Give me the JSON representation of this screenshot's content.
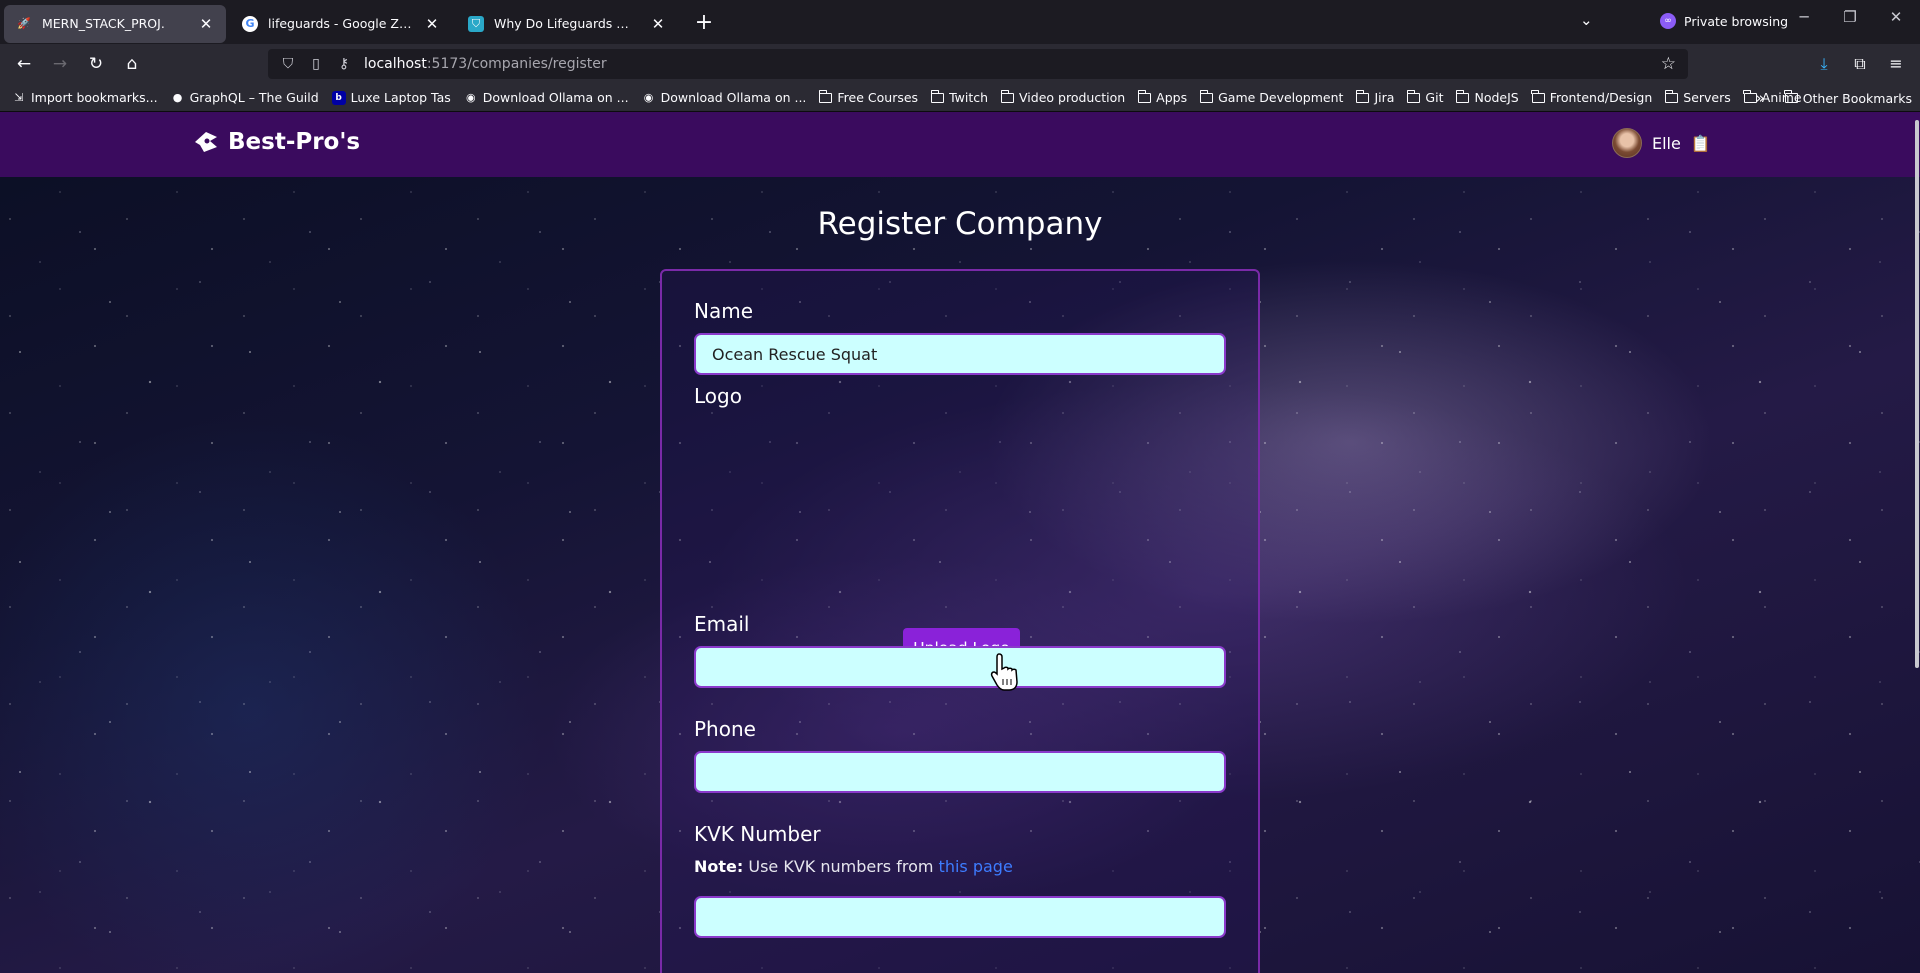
{
  "browser": {
    "tabs": [
      {
        "title": "MERN_STACK_PROJ.",
        "active": true,
        "favicon": "rocket-icon"
      },
      {
        "title": "lifeguards - Google Zoeken",
        "active": false,
        "favicon": "google-icon"
      },
      {
        "title": "Why Do Lifeguards Wear Red?",
        "active": false,
        "favicon": "shield-icon"
      }
    ],
    "private_label": "Private browsing",
    "url_host": "localhost",
    "url_path": ":5173/companies/register",
    "bookmarks": [
      {
        "label": "Import bookmarks...",
        "icon": "import-icon"
      },
      {
        "label": "GraphQL – The Guild",
        "icon": "guild-icon"
      },
      {
        "label": "Luxe Laptop Tas",
        "icon": "bol-icon"
      },
      {
        "label": "Download Ollama on ...",
        "icon": "ollama-icon"
      },
      {
        "label": "Download Ollama on ...",
        "icon": "ollama-icon"
      },
      {
        "label": "Free Courses",
        "icon": "folder-icon"
      },
      {
        "label": "Twitch",
        "icon": "folder-icon"
      },
      {
        "label": "Video production",
        "icon": "folder-icon"
      },
      {
        "label": "Apps",
        "icon": "folder-icon"
      },
      {
        "label": "Game Development",
        "icon": "folder-icon"
      },
      {
        "label": "Jira",
        "icon": "folder-icon"
      },
      {
        "label": "Git",
        "icon": "folder-icon"
      },
      {
        "label": "NodeJS",
        "icon": "folder-icon"
      },
      {
        "label": "Frontend/Design",
        "icon": "folder-icon"
      },
      {
        "label": "Servers",
        "icon": "folder-icon"
      },
      {
        "label": "Anime",
        "icon": "folder-icon"
      }
    ],
    "other_bookmarks": "Other Bookmarks"
  },
  "app": {
    "brand": "Best-Pro's",
    "user_name": "Elle",
    "colors": {
      "nav": "#3a0b5e",
      "accent": "#8a22d9",
      "input_bg": "#ccffff",
      "link": "#3d7cff"
    }
  },
  "form": {
    "title": "Register Company",
    "name_label": "Name",
    "name_value": "Ocean Rescue Squat",
    "logo_label": "Logo",
    "upload_button": "Upload Logo",
    "email_label": "Email",
    "email_value": "",
    "phone_label": "Phone",
    "phone_value": "",
    "kvk_label": "KVK Number",
    "note_bold": "Note:",
    "note_text": " Use KVK numbers from ",
    "note_link": "this page",
    "kvk_value": ""
  }
}
